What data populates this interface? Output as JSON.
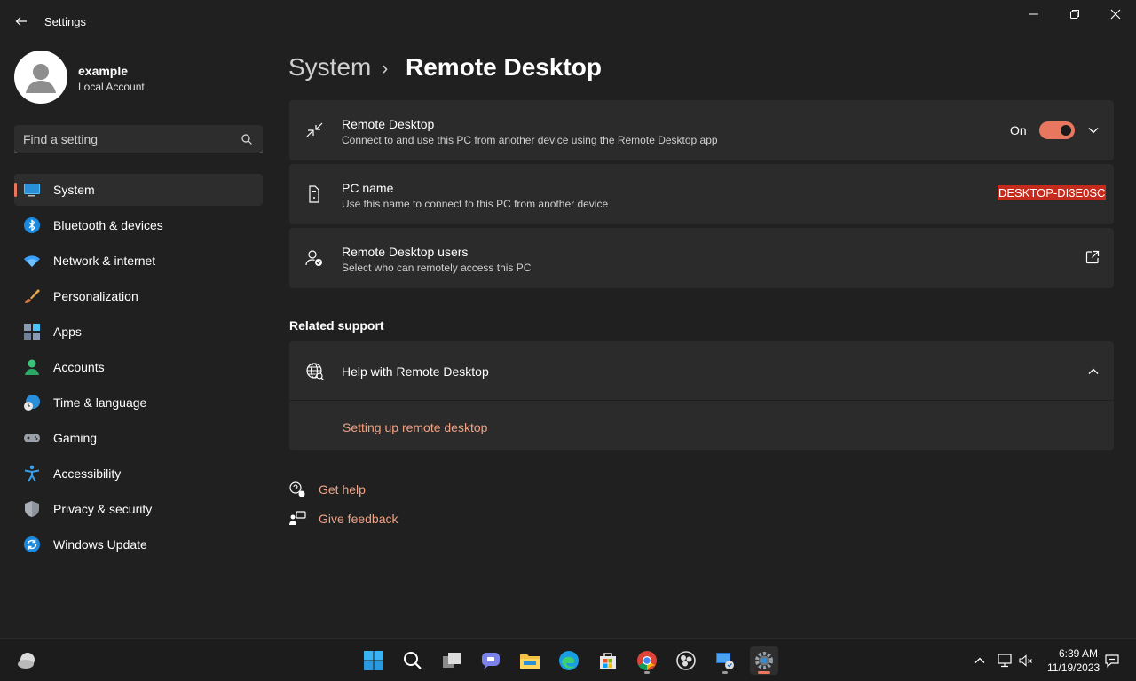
{
  "window": {
    "title": "Settings"
  },
  "profile": {
    "name": "example",
    "account_type": "Local Account"
  },
  "search": {
    "placeholder": "Find a setting"
  },
  "sidebar": {
    "items": [
      {
        "label": "System",
        "icon": "system-icon",
        "active": true
      },
      {
        "label": "Bluetooth & devices",
        "icon": "bluetooth-icon"
      },
      {
        "label": "Network & internet",
        "icon": "wifi-icon"
      },
      {
        "label": "Personalization",
        "icon": "brush-icon"
      },
      {
        "label": "Apps",
        "icon": "apps-icon"
      },
      {
        "label": "Accounts",
        "icon": "person-icon"
      },
      {
        "label": "Time & language",
        "icon": "globe-clock-icon"
      },
      {
        "label": "Gaming",
        "icon": "gamepad-icon"
      },
      {
        "label": "Accessibility",
        "icon": "accessibility-icon"
      },
      {
        "label": "Privacy & security",
        "icon": "shield-icon"
      },
      {
        "label": "Windows Update",
        "icon": "update-icon"
      }
    ]
  },
  "breadcrumb": {
    "parent": "System",
    "separator": "›",
    "current": "Remote Desktop"
  },
  "remote_desktop": {
    "title": "Remote Desktop",
    "description": "Connect to and use this PC from another device using the Remote Desktop app",
    "toggle_label": "On",
    "enabled": true
  },
  "pc_name": {
    "title": "PC name",
    "description": "Use this name to connect to this PC from another device",
    "value": "DESKTOP-DI3E0SC"
  },
  "rd_users": {
    "title": "Remote Desktop users",
    "description": "Select who can remotely access this PC"
  },
  "related_support": {
    "heading": "Related support",
    "help_title": "Help with Remote Desktop",
    "link": "Setting up remote desktop"
  },
  "footer": {
    "get_help": "Get help",
    "give_feedback": "Give feedback"
  },
  "taskbar": {
    "time": "6:39 AM",
    "date": "11/19/2023",
    "apps": [
      "start-icon",
      "search-icon",
      "task-view-icon",
      "chat-icon",
      "file-explorer-icon",
      "edge-icon",
      "store-icon",
      "chrome-icon",
      "obs-icon",
      "network-app-icon",
      "settings-icon"
    ]
  },
  "colors": {
    "accent": "#e97760",
    "background": "#202020",
    "card": "#2b2b2b",
    "highlight": "#c42b1c"
  }
}
